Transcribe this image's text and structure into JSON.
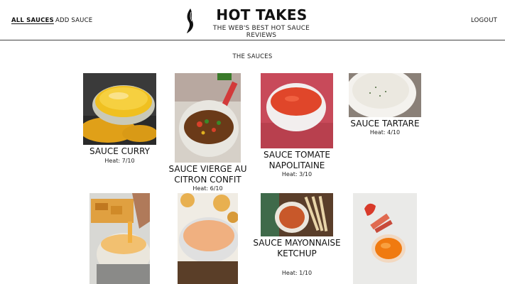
{
  "nav": {
    "all_sauces": "ALL SAUCES",
    "add_sauce": "ADD SAUCE",
    "logout": "LOGOUT"
  },
  "brand": {
    "title": "HOT TAKES",
    "subtitle": "THE WEB'S BEST HOT SAUCE REVIEWS"
  },
  "section_title": "THE SAUCES",
  "sauces": [
    {
      "name": "SAUCE CURRY",
      "heat": "Heat: 7/10"
    },
    {
      "name": "SAUCE VIERGE AU CITRON CONFIT",
      "heat": "Heat: 6/10"
    },
    {
      "name": "SAUCE TOMATE NAPOLITAINE",
      "heat": "Heat: 3/10"
    },
    {
      "name": "SAUCE TARTARE",
      "heat": "Heat: 4/10"
    },
    {
      "name": "SAUCE MAYONNAISE KETCHUP",
      "heat": "Heat: 1/10"
    }
  ],
  "colors": {
    "accent": "#111111",
    "divider": "#444444"
  }
}
